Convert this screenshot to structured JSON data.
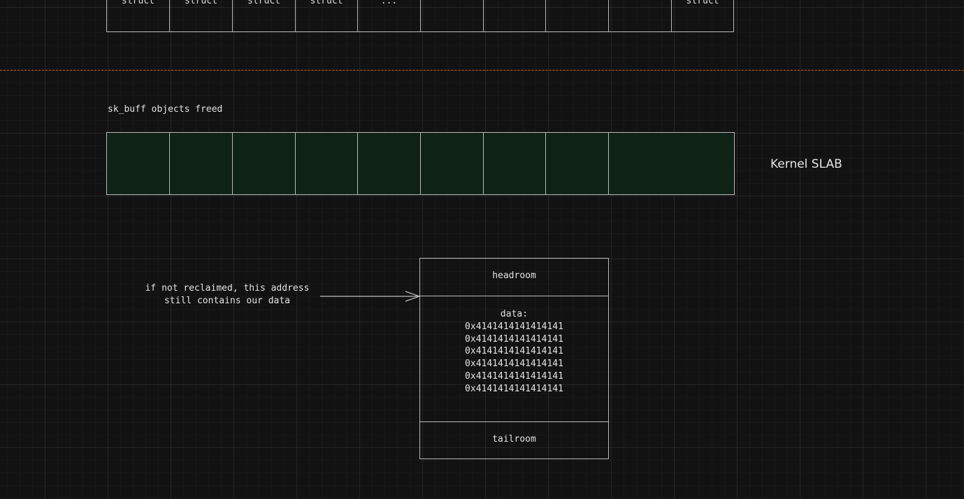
{
  "top_row": {
    "cells": [
      "struct",
      "struct",
      "struct",
      "struct",
      "...",
      "",
      "",
      "",
      "",
      "struct"
    ]
  },
  "freed_label": "sk_buff objects freed",
  "slab": {
    "label": "Kernel SLAB",
    "cell_count": 9,
    "state": "freed",
    "fill_color": "#0e2315"
  },
  "colors": {
    "background": "#121212",
    "divider": "#b9622a",
    "border": "#b8b8b8"
  },
  "annotation": {
    "lines": [
      "if not reclaimed, this address",
      "still contains our data"
    ]
  },
  "skbuff": {
    "headroom": "headroom",
    "data_label": "data:",
    "data_values": [
      "0x4141414141414141",
      "0x4141414141414141",
      "0x4141414141414141",
      "0x4141414141414141",
      "0x4141414141414141",
      "0x4141414141414141"
    ],
    "tailroom": "tailroom"
  }
}
